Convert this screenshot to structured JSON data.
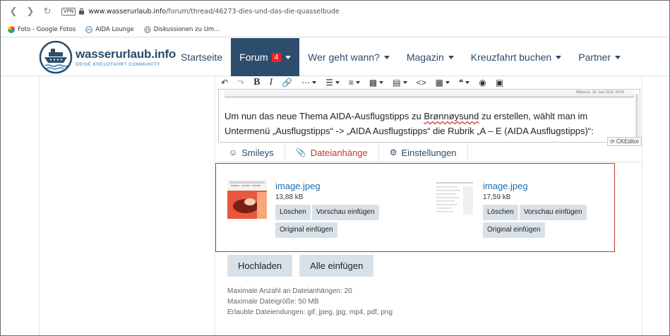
{
  "browser": {
    "vpn_label": "VPN",
    "url_host": "www.wasserurlaub.info",
    "url_path": "/forum/thread/46273-dies-und-das-die-quasselbude",
    "bookmarks": [
      {
        "label": "Foto - Google Fotos",
        "icon": "google-photos-icon"
      },
      {
        "label": "AIDA Lounge",
        "icon": "aida-icon"
      },
      {
        "label": "Diskussionen zu Um...",
        "icon": "globe-icon"
      }
    ]
  },
  "site": {
    "logo_name": "wasserurlaub.info",
    "logo_tagline": "DEINE KREUZFAHRT COMMUNITY",
    "nav": [
      {
        "label": "Startseite",
        "has_menu": false,
        "active": false
      },
      {
        "label": "Forum",
        "has_menu": true,
        "active": true,
        "badge": "4"
      },
      {
        "label": "Wer geht wann?",
        "has_menu": true,
        "active": false
      },
      {
        "label": "Magazin",
        "has_menu": true,
        "active": false
      },
      {
        "label": "Kreuzfahrt buchen",
        "has_menu": true,
        "active": false
      },
      {
        "label": "Partner",
        "has_menu": true,
        "active": false
      }
    ],
    "colors": {
      "brand": "#2d4d6d",
      "badge": "#e5262b",
      "link": "#1f6fad",
      "attach_border": "#c0393b"
    }
  },
  "editor": {
    "image_strip_caption": "Mittwoch, 18. Juni 2014, 09:00",
    "text_line1_a": "Um nun das neue Thema AIDA-Ausflugstipps zu ",
    "text_line1_spell": "Brønnøysund",
    "text_line1_b": " zu erstellen, wählt man im",
    "text_line2": "Untermenü „Ausflugstipps“ -> „AIDA Ausflugstipps“ die Rubrik „A – E (AIDA Ausflugstipps)“:",
    "ck_label": "CKEditor",
    "tabs": [
      {
        "label": "Smileys",
        "icon": "smiley-icon",
        "active": false
      },
      {
        "label": "Dateianhänge",
        "icon": "paperclip-icon",
        "active": true
      },
      {
        "label": "Einstellungen",
        "icon": "gear-icon",
        "active": false
      }
    ]
  },
  "attachments": [
    {
      "name": "image.jpeg",
      "size": "13,88 kB",
      "btn_delete": "Löschen",
      "btn_preview": "Vorschau einfügen",
      "btn_original": "Original einfügen"
    },
    {
      "name": "image.jpeg",
      "size": "17,59 kB",
      "btn_delete": "Löschen",
      "btn_preview": "Vorschau einfügen",
      "btn_original": "Original einfügen"
    }
  ],
  "upload": {
    "btn_upload": "Hochladen",
    "btn_insert_all": "Alle einfügen",
    "max_count": "Maximale Anzahl an Dateianhängen: 20",
    "max_size": "Maximale Dateigröße: 50 MB",
    "allowed_ext": "Erlaubte Dateiendungen: gif, jpeg, jpg, mp4, pdf, png"
  }
}
